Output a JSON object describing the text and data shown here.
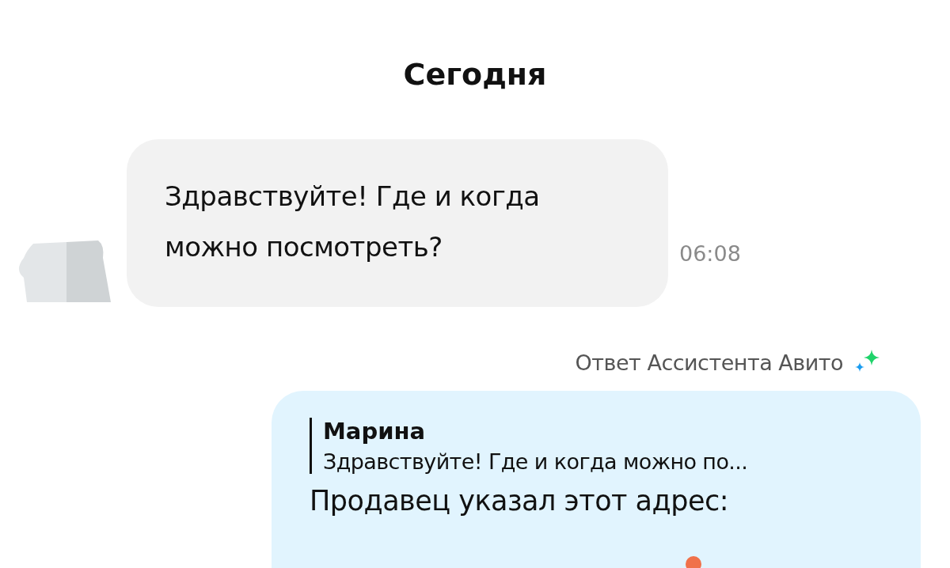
{
  "date_header": "Сегодня",
  "messages": [
    {
      "kind": "incoming",
      "text": "Здравствуйте! Где и когда можно посмотреть?",
      "time": "06:08"
    },
    {
      "kind": "outgoing",
      "label": "Ответ Ассистента Авито",
      "quote": {
        "author": "Марина",
        "text": "Здравствуйте! Где и когда можно по..."
      },
      "text": "Продавец указал этот адрес:"
    }
  ]
}
